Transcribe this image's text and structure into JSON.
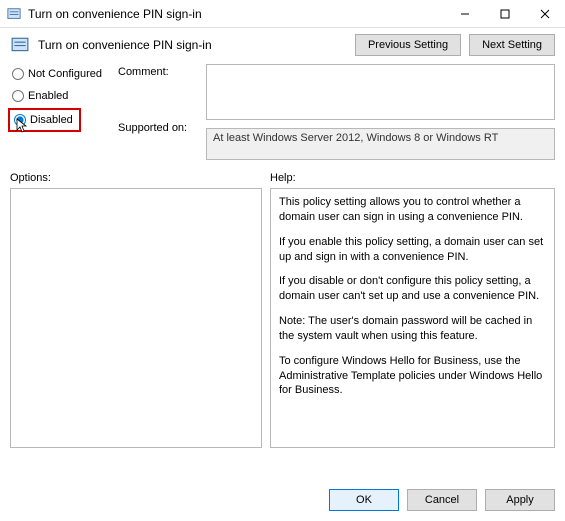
{
  "window": {
    "title": "Turn on convenience PIN sign-in"
  },
  "header": {
    "title": "Turn on convenience PIN sign-in",
    "prev_label": "Previous Setting",
    "next_label": "Next Setting"
  },
  "radios": {
    "not_configured": "Not Configured",
    "enabled": "Enabled",
    "disabled": "Disabled",
    "selected": "disabled"
  },
  "labels": {
    "comment": "Comment:",
    "supported": "Supported on:",
    "options": "Options:",
    "help": "Help:"
  },
  "fields": {
    "comment_value": "",
    "supported_text": "At least Windows Server 2012, Windows 8 or Windows RT"
  },
  "help": {
    "p1": "This policy setting allows you to control whether a domain user can sign in using a convenience PIN.",
    "p2": "If you enable this policy setting, a domain user can set up and sign in with a convenience PIN.",
    "p3": "If you disable or don't configure this policy setting, a domain user can't set up and use a convenience PIN.",
    "p4": "Note: The user's domain password will be cached in the system vault when using this feature.",
    "p5": "To configure Windows Hello for Business, use the Administrative Template policies under Windows Hello for Business."
  },
  "footer": {
    "ok": "OK",
    "cancel": "Cancel",
    "apply": "Apply"
  }
}
